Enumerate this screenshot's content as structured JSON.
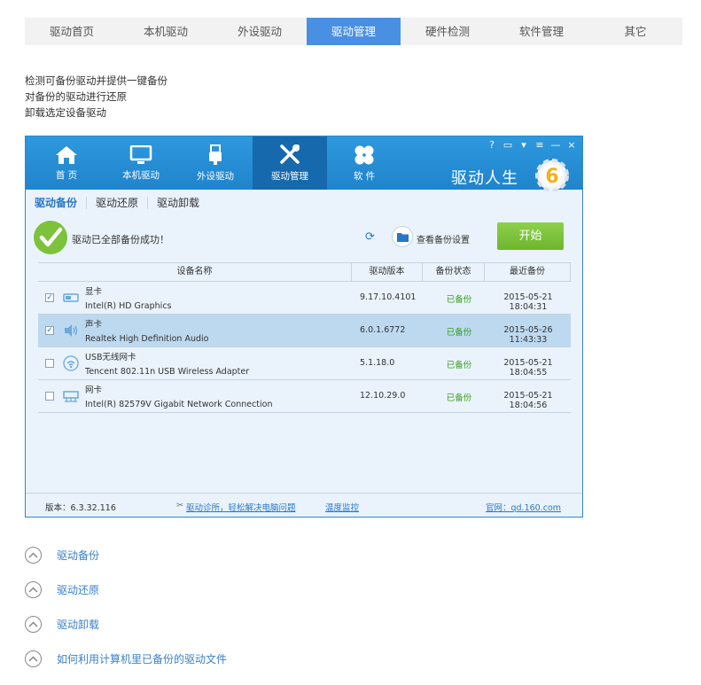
{
  "topnav": [
    "驱动首页",
    "本机驱动",
    "外设驱动",
    "驱动管理",
    "硬件检测",
    "软件管理",
    "其它"
  ],
  "description": [
    "检测可备份驱动并提供一键备份",
    "对备份的驱动进行还原",
    "卸载选定设备驱动"
  ],
  "app": {
    "nav": [
      "首 页",
      "本机驱动",
      "外设驱动",
      "驱动管理",
      "软 件"
    ],
    "brand": "驱动人生",
    "subtabs": [
      "驱动备份",
      "驱动还原",
      "驱动卸载"
    ],
    "status_message": "驱动已全部备份成功！",
    "backup_settings": "查看备份设置",
    "start_button": "开始",
    "table": {
      "headers": [
        "设备名称",
        "驱动版本",
        "备份状态",
        "最近备份"
      ],
      "rows": [
        {
          "category": "显卡",
          "device": "Intel(R) HD Graphics",
          "version": "9.17.10.4101",
          "status": "已备份",
          "date": "2015-05-21 18:04:31",
          "checked": "✓"
        },
        {
          "category": "声卡",
          "device": "Realtek High Definition Audio",
          "version": "6.0.1.6772",
          "status": "已备份",
          "date": "2015-05-26 11:43:33",
          "checked": "✓"
        },
        {
          "category": "USB无线网卡",
          "device": "Tencent 802.11n USB Wireless Adapter",
          "version": "5.1.18.0",
          "status": "已备份",
          "date": "2015-05-21 18:04:55",
          "checked": ""
        },
        {
          "category": "网卡",
          "device": "Intel(R) 82579V Gigabit Network Connection",
          "version": "12.10.29.0",
          "status": "已备份",
          "date": "2015-05-21 18:04:56",
          "checked": ""
        }
      ]
    },
    "footer": {
      "version": "版本：6.3.32.116",
      "clinic": "驱动诊所，轻松解决电脑问题",
      "temp": "温度监控",
      "website": "官网：qd.160.com"
    }
  },
  "faq": [
    "驱动备份",
    "驱动还原",
    "驱动卸载",
    "如何利用计算机里已备份的驱动文件"
  ],
  "colors": {
    "accent": "#4a90e2",
    "app_header": "#2e98dd",
    "start_button": "#7cc23c",
    "status_ok": "#3a9e1e"
  }
}
